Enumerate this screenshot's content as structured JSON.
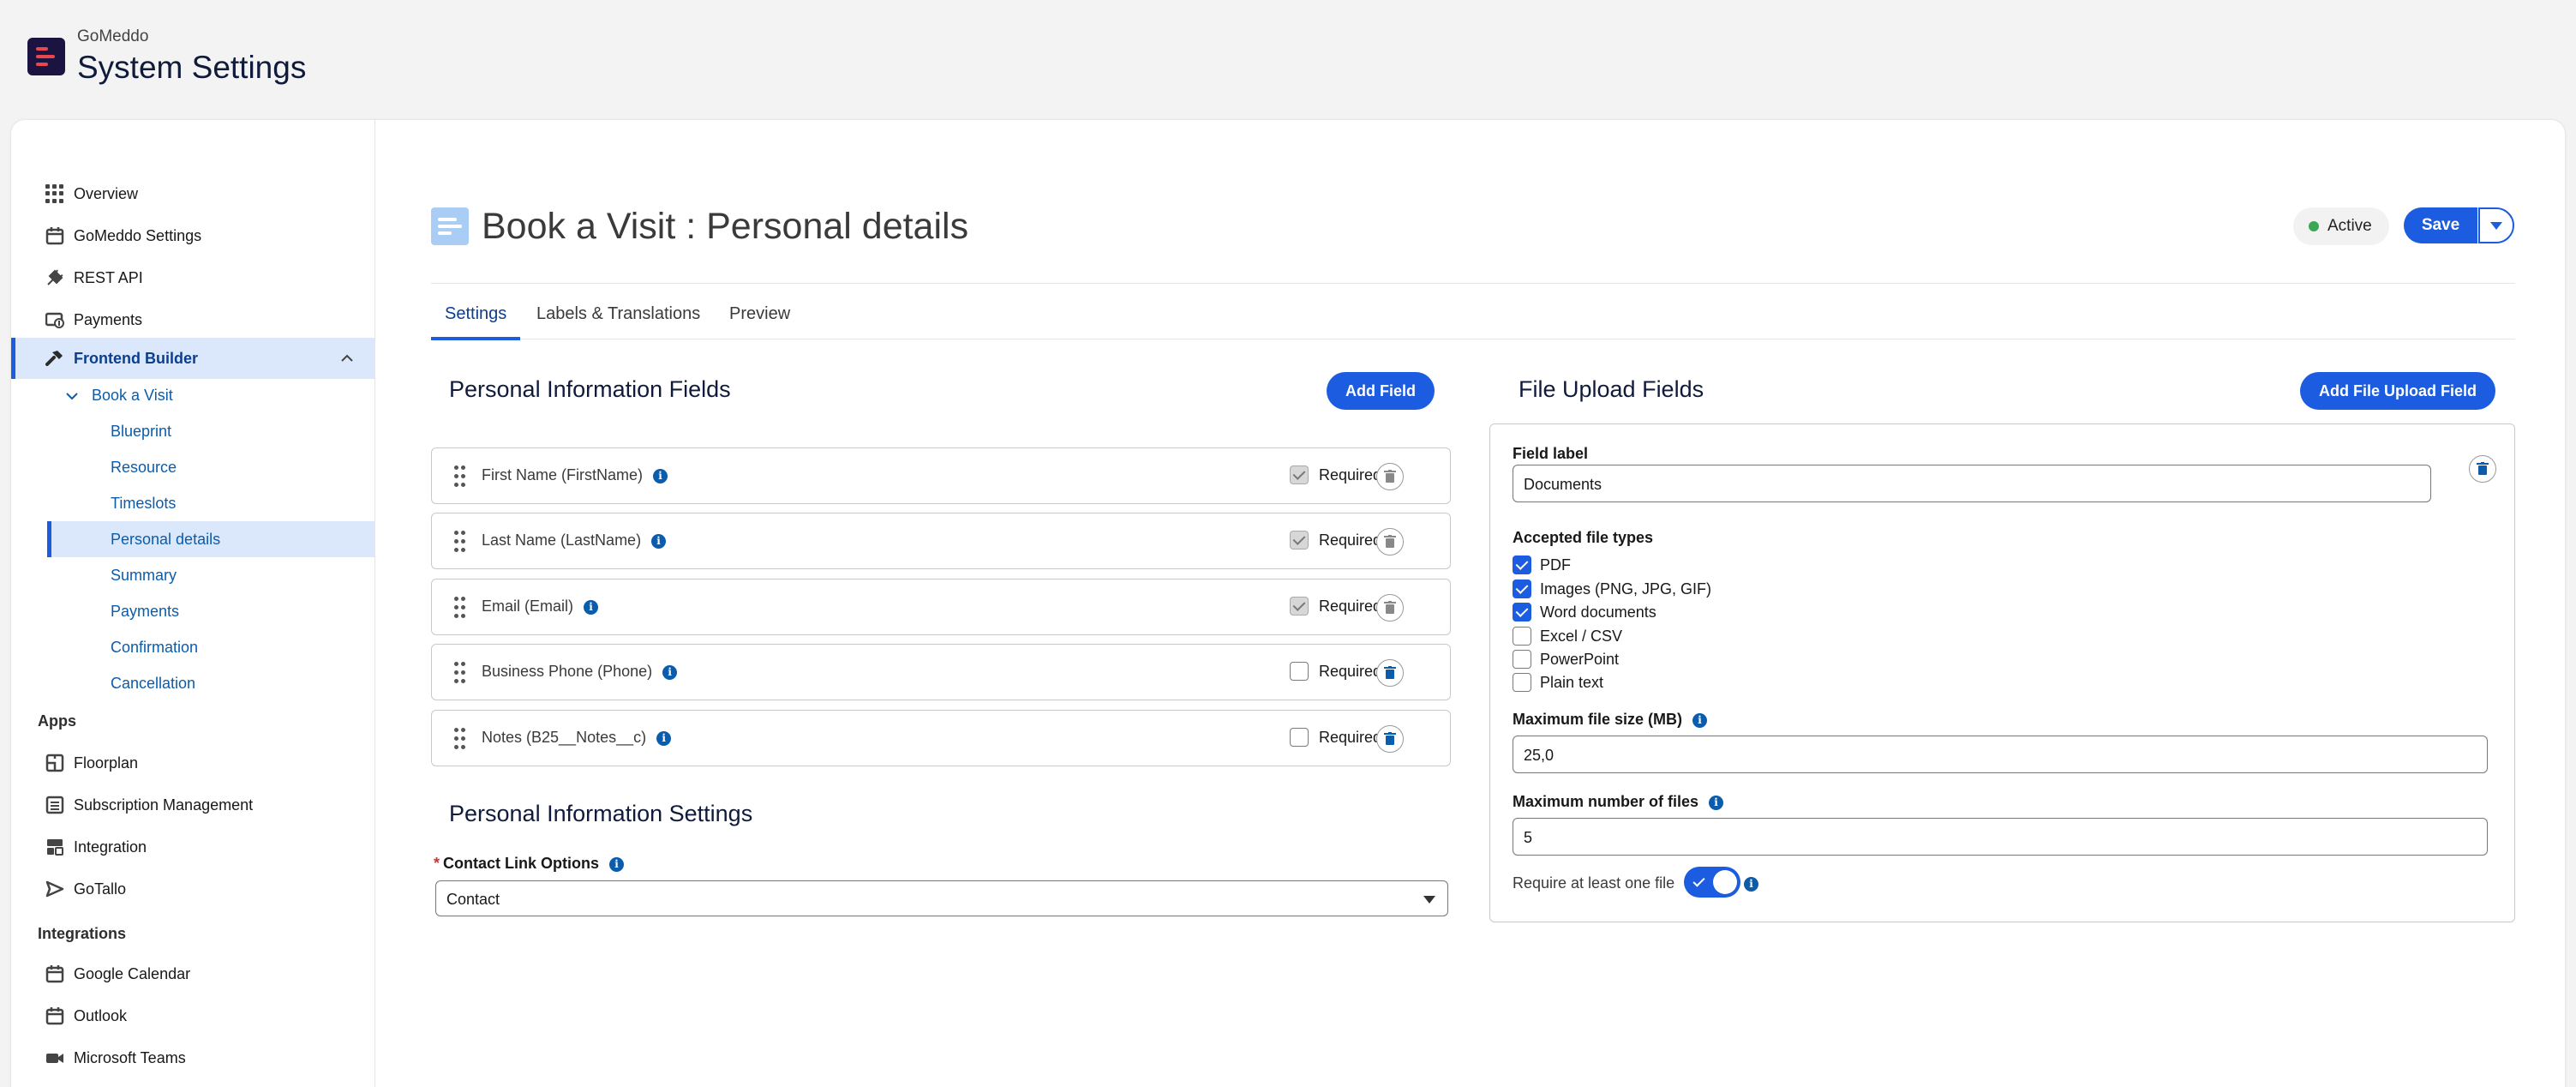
{
  "app": {
    "name": "GoMeddo",
    "title": "System Settings"
  },
  "sidebar": {
    "items": [
      {
        "label": "Overview",
        "icon": "grid-icon"
      },
      {
        "label": "GoMeddo Settings",
        "icon": "calendar-icon"
      },
      {
        "label": "REST API",
        "icon": "plug-icon"
      },
      {
        "label": "Payments",
        "icon": "payment-icon"
      },
      {
        "label": "Frontend Builder",
        "icon": "hammer-icon"
      }
    ],
    "book_a_visit": "Book a Visit",
    "sub_items": [
      "Blueprint",
      "Resource",
      "Timeslots",
      "Personal details",
      "Summary",
      "Payments",
      "Confirmation",
      "Cancellation"
    ],
    "apps_label": "Apps",
    "apps": [
      {
        "label": "Floorplan",
        "icon": "floorplan-icon"
      },
      {
        "label": "Subscription Management",
        "icon": "list-icon"
      },
      {
        "label": "Integration",
        "icon": "integration-icon"
      },
      {
        "label": "GoTallo",
        "icon": "send-icon"
      }
    ],
    "integrations_label": "Integrations",
    "integrations": [
      {
        "label": "Google Calendar",
        "icon": "calendar-icon"
      },
      {
        "label": "Outlook",
        "icon": "calendar-icon"
      },
      {
        "label": "Microsoft Teams",
        "icon": "video-icon"
      }
    ]
  },
  "page": {
    "title": "Book a Visit : Personal details",
    "status": "Active",
    "save_label": "Save",
    "status_color": "#3ba755",
    "accent": "#1b5ce0"
  },
  "tabs": [
    "Settings",
    "Labels & Translations",
    "Preview"
  ],
  "personal_fields": {
    "title": "Personal Information Fields",
    "add_label": "Add Field",
    "required_label": "Required",
    "rows": [
      {
        "name": "First Name (FirstName)",
        "required": true,
        "locked": true
      },
      {
        "name": "Last Name (LastName)",
        "required": true,
        "locked": true
      },
      {
        "name": "Email (Email)",
        "required": true,
        "locked": true
      },
      {
        "name": "Business Phone (Phone)",
        "required": false,
        "locked": false
      },
      {
        "name": "Notes (B25__Notes__c)",
        "required": false,
        "locked": false
      }
    ]
  },
  "personal_settings": {
    "title": "Personal Information Settings",
    "contact_link_label": "Contact Link Options",
    "contact_link_value": "Contact"
  },
  "file_upload": {
    "title": "File Upload Fields",
    "add_label": "Add File Upload Field",
    "field_label_label": "Field label",
    "field_label_value": "Documents",
    "accepted_label": "Accepted file types",
    "types": [
      {
        "label": "PDF",
        "checked": true
      },
      {
        "label": "Images (PNG, JPG, GIF)",
        "checked": true
      },
      {
        "label": "Word documents",
        "checked": true
      },
      {
        "label": "Excel / CSV",
        "checked": false
      },
      {
        "label": "PowerPoint",
        "checked": false
      },
      {
        "label": "Plain text",
        "checked": false
      }
    ],
    "max_size_label": "Maximum file size (MB)",
    "max_size_value": "25,0",
    "max_files_label": "Maximum number of files",
    "max_files_value": "5",
    "require_label": "Require at least one file",
    "require_on": true
  }
}
